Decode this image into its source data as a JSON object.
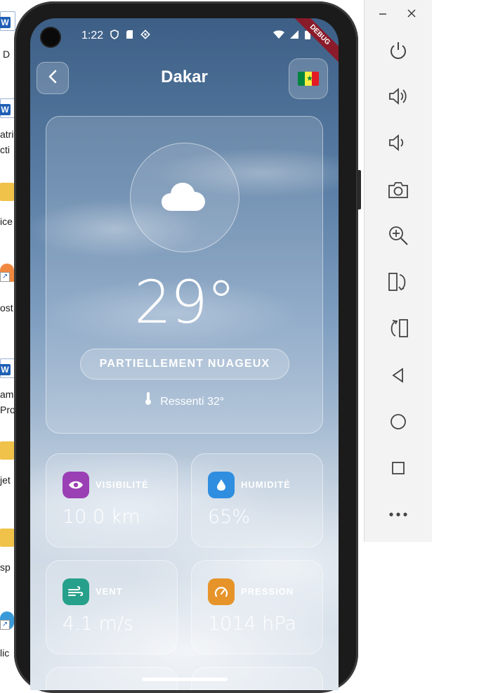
{
  "desktop": {
    "icons": [
      {
        "type": "word",
        "label": "D"
      },
      {
        "type": "word",
        "label": "atri\ncti"
      },
      {
        "type": "folder",
        "label": "ice"
      },
      {
        "type": "shortcut",
        "label": "ost"
      },
      {
        "type": "word",
        "label": "am\nPro"
      },
      {
        "type": "folder",
        "label": "jet"
      },
      {
        "type": "folder",
        "label": "sp"
      },
      {
        "type": "net",
        "label": "lic"
      }
    ]
  },
  "status_bar": {
    "time": "1:22",
    "left_icons": [
      "shield-icon",
      "sd-card-icon",
      "vpn-icon"
    ],
    "right_icons": [
      "wifi-icon",
      "signal-icon",
      "battery-icon"
    ],
    "debug_banner": "DEBUG"
  },
  "header": {
    "city": "Dakar",
    "flag": "Senegal"
  },
  "main_card": {
    "icon": "cloud-icon",
    "temperature": "29°",
    "condition": "PARTIELLEMENT NUAGEUX",
    "feels_like": "Ressenti 32°"
  },
  "stats": [
    {
      "label": "VISIBILITÉ",
      "value": "10.0 km",
      "icon": "eye-icon",
      "color": "#9b3fb5"
    },
    {
      "label": "HUMIDITÉ",
      "value": "65%",
      "icon": "drop-icon",
      "color": "#2f8ee0"
    },
    {
      "label": "VENT",
      "value": "4.1 m/s",
      "icon": "wind-icon",
      "color": "#26a08a"
    },
    {
      "label": "PRESSION",
      "value": "1014 hPa",
      "icon": "gauge-icon",
      "color": "#e6942a"
    }
  ],
  "emulator_toolbar": {
    "window_controls": [
      "minimize-icon",
      "close-icon"
    ],
    "tools": [
      "power-icon",
      "volume-up-icon",
      "volume-down-icon",
      "camera-icon",
      "zoom-icon",
      "rotate-left-icon",
      "rotate-right-icon",
      "back-icon",
      "home-icon",
      "overview-icon",
      "more-icon"
    ]
  },
  "colors": {
    "debug_banner": "#8a1b2a",
    "glass_border": "rgba(255,255,255,0.45)"
  }
}
